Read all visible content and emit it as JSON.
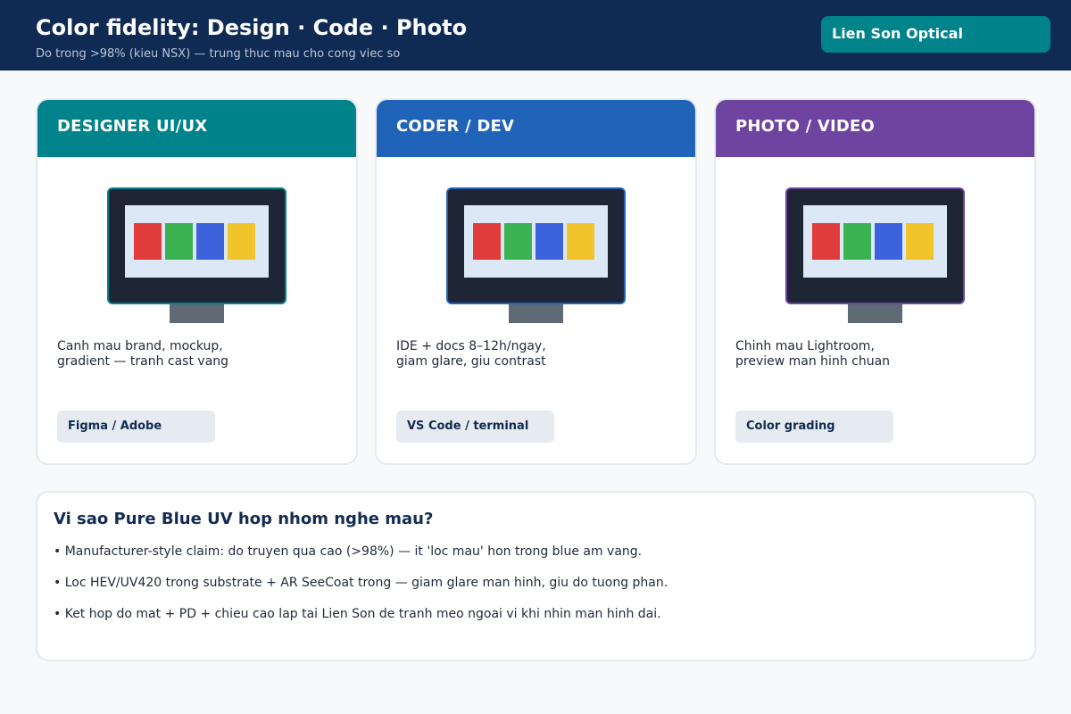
{
  "header": {
    "title": "Color fidelity: Design · Code · Photo",
    "subtitle": "Do trong >98% (kieu NSX) — trung thuc mau cho cong viec so",
    "brand": "Lien Son Optical"
  },
  "colors": {
    "header_bg": "#0f2a53",
    "brand_bg": "#00838a",
    "designer": "#00838a",
    "coder": "#1f64b8",
    "photo": "#6f44a1",
    "swatches": [
      "#e03c3c",
      "#3bb353",
      "#3d63dc",
      "#f0c42a"
    ]
  },
  "cards": [
    {
      "title": "DESIGNER UI/UX",
      "color": "#00838a",
      "desc_lines": [
        "Canh mau brand, mockup,",
        "gradient — tranh cast vang"
      ],
      "tag": "Figma / Adobe"
    },
    {
      "title": "CODER / DEV",
      "color": "#1f64b8",
      "desc_lines": [
        "IDE + docs 8–12h/ngay,",
        "giam glare, giu contrast"
      ],
      "tag": "VS Code / terminal"
    },
    {
      "title": "PHOTO / VIDEO",
      "color": "#6f44a1",
      "desc_lines": [
        "Chinh mau Lightroom,",
        "preview man hinh chuan"
      ],
      "tag": "Color grading"
    }
  ],
  "why": {
    "title": "Vi sao Pure Blue UV hop nhom nghe mau?",
    "bullets": [
      "• Manufacturer-style claim: do truyen qua cao (>98%) — it 'loc mau' hon trong blue am vang.",
      "• Loc HEV/UV420 trong substrate + AR SeeCoat trong — giam glare man hinh, giu do tuong phan.",
      "• Ket hop do mat + PD + chieu cao lap tai Lien Son de tranh meo ngoai vi khi nhin man hinh dai."
    ]
  }
}
